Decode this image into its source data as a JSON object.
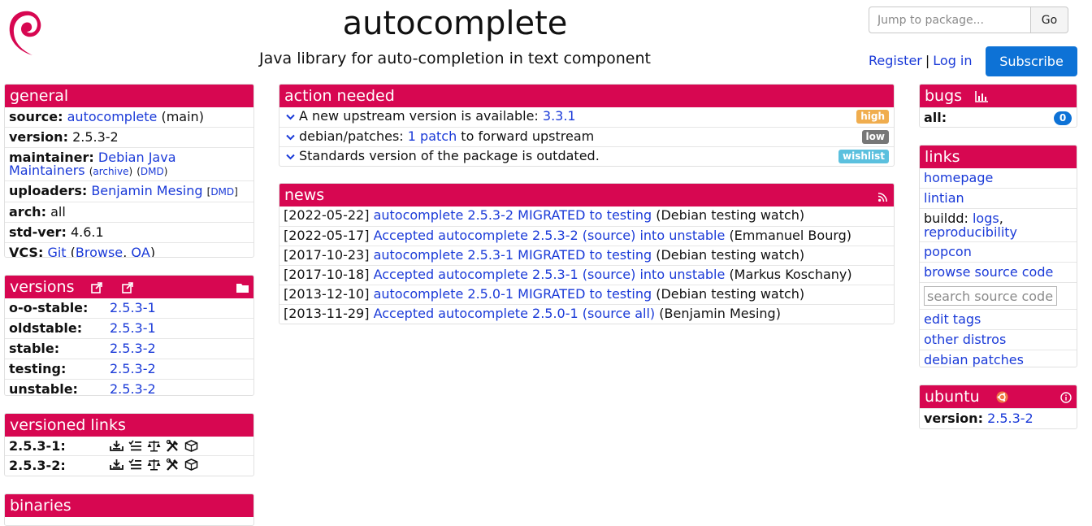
{
  "header": {
    "title": "autocomplete",
    "subtitle": "Java library for auto-completion in text component",
    "jump_placeholder": "Jump to package...",
    "go_label": "Go",
    "register_label": "Register",
    "separator": "|",
    "login_label": "Log in",
    "subscribe_label": "Subscribe"
  },
  "general": {
    "heading": "general",
    "source_key": "source:",
    "source_value": "autocomplete",
    "source_suffix": "(main)",
    "version_key": "version:",
    "version_value": "2.5.3-2",
    "maintainer_key": "maintainer:",
    "maintainer_value": "Debian Java Maintainers",
    "maintainer_archive": "archive",
    "maintainer_dmd": "DMD",
    "uploaders_key": "uploaders:",
    "uploaders_value": "Benjamin Mesing",
    "uploaders_dmd": "DMD",
    "arch_key": "arch:",
    "arch_value": "all",
    "stdver_key": "std-ver:",
    "stdver_value": "4.6.1",
    "vcs_key": "VCS:",
    "vcs_git": "Git",
    "vcs_browse": "Browse",
    "vcs_qa": "QA"
  },
  "versions": {
    "heading": "versions",
    "rows": [
      {
        "suite": "o-o-stable:",
        "version": "2.5.3-1"
      },
      {
        "suite": "oldstable:",
        "version": "2.5.3-1"
      },
      {
        "suite": "stable:",
        "version": "2.5.3-2"
      },
      {
        "suite": "testing:",
        "version": "2.5.3-2"
      },
      {
        "suite": "unstable:",
        "version": "2.5.3-2"
      }
    ]
  },
  "versioned_links": {
    "heading": "versioned links",
    "rows": [
      {
        "version": "2.5.3-1:"
      },
      {
        "version": "2.5.3-2:"
      }
    ]
  },
  "binaries": {
    "heading": "binaries"
  },
  "action_needed": {
    "heading": "action needed",
    "items": [
      {
        "text": "A new upstream version is available: ",
        "link": "3.3.1",
        "after": "",
        "severity": "high"
      },
      {
        "text": "debian/patches: ",
        "link": "1 patch",
        "after": " to forward upstream",
        "severity": "low"
      },
      {
        "text": "Standards version of the package is outdated.",
        "link": "",
        "after": "",
        "severity": "wishlist"
      }
    ]
  },
  "news": {
    "heading": "news",
    "items": [
      {
        "date": "[2022-05-22]",
        "link": "autocomplete 2.5.3-2 MIGRATED to testing",
        "by": "(Debian testing watch)"
      },
      {
        "date": "[2022-05-17]",
        "link": "Accepted autocomplete 2.5.3-2 (source) into unstable",
        "by": "(Emmanuel Bourg)"
      },
      {
        "date": "[2017-10-23]",
        "link": "autocomplete 2.5.3-1 MIGRATED to testing",
        "by": "(Debian testing watch)"
      },
      {
        "date": "[2017-10-18]",
        "link": "Accepted autocomplete 2.5.3-1 (source) into unstable",
        "by": "(Markus Koschany)"
      },
      {
        "date": "[2013-12-10]",
        "link": "autocomplete 2.5.0-1 MIGRATED to testing",
        "by": "(Debian testing watch)"
      },
      {
        "date": "[2013-11-29]",
        "link": "Accepted autocomplete 2.5.0-1 (source all)",
        "by": "(Benjamin Mesing)"
      }
    ]
  },
  "bugs": {
    "heading": "bugs",
    "all_key": "all:",
    "all_count": "0"
  },
  "links": {
    "heading": "links",
    "homepage": "homepage",
    "lintian": "lintian",
    "buildd_label": "buildd:",
    "buildd_logs": "logs",
    "buildd_repro": "reproducibility",
    "popcon": "popcon",
    "browse_source": "browse source code",
    "search_placeholder": "search source code",
    "edit_tags": "edit tags",
    "other_distros": "other distros",
    "debian_patches": "debian patches"
  },
  "ubuntu": {
    "heading": "ubuntu",
    "version_key": "version:",
    "version_value": "2.5.3-2"
  },
  "colors": {
    "header_accent": "#d70751",
    "link": "#1a3ad8",
    "primary_button": "#0d72d6",
    "badge_high": "#f0ad4e",
    "badge_low": "#777777",
    "badge_wishlist": "#5bc0de"
  },
  "icons": [
    "debian-swirl-logo-icon",
    "external-link-icon",
    "folder-icon",
    "bar-chart-icon",
    "rss-icon",
    "ubuntu-logo-icon",
    "info-icon",
    "download-icon",
    "checklist-icon",
    "scales-icon",
    "tools-icon",
    "package-icon",
    "chevron-down-icon"
  ]
}
